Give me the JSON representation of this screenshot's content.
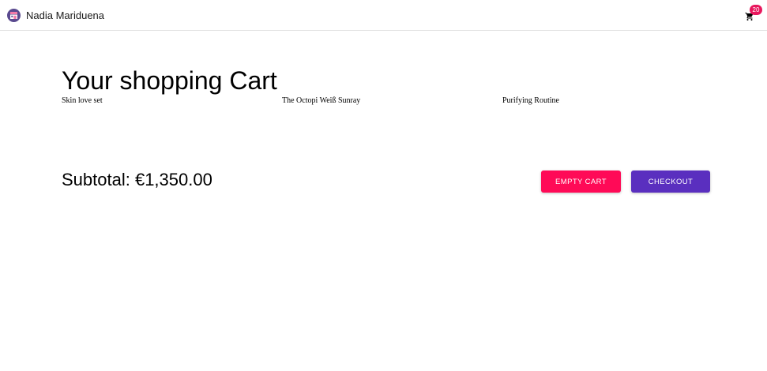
{
  "header": {
    "brand_name": "Nadia Mariduena",
    "logo_icon": "storefront-icon",
    "cart_icon": "shopping-cart-icon",
    "cart_count": "20",
    "badge_color": "#e8175d"
  },
  "main": {
    "title": "Your shopping Cart",
    "products": [
      {
        "name": "Skin love set"
      },
      {
        "name": "The Octopi Weiß Sunray"
      },
      {
        "name": "Purifying Routine"
      }
    ],
    "subtotal": "Subtotal: €1,350.00",
    "empty_cart_label": "Empty Cart",
    "checkout_label": "Checkout",
    "empty_cart_color": "#ff0a57",
    "checkout_color": "#5a2fbf"
  }
}
